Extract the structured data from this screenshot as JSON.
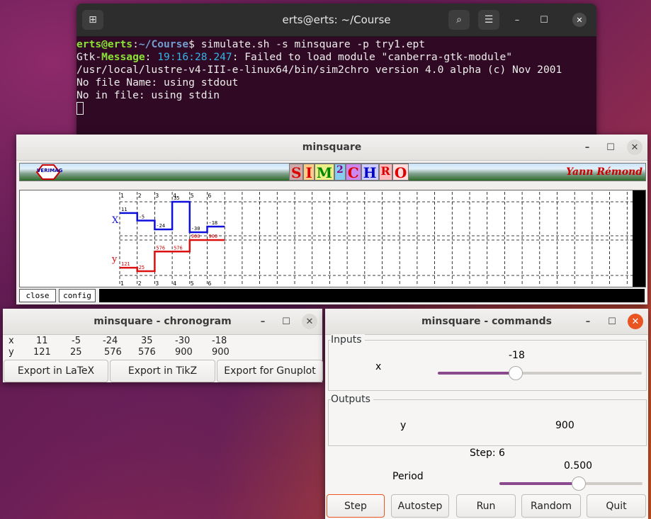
{
  "terminal": {
    "title": "erts@erts: ~/Course",
    "newtab_icon": "new-tab-icon",
    "lines": {
      "prompt_user": "erts@erts",
      "prompt_sep": ":",
      "prompt_path": "~/Course",
      "prompt_cmd": "$ simulate.sh -s minsquare -p try1.ept",
      "msg_tag": "Gtk-",
      "msg_tag2": "Message",
      "msg_colon": ": ",
      "msg_time": "19:16:28.247",
      "msg_text": ": Failed to load module \"canberra-gtk-module\"",
      "l3": "/usr/local/lustre-v4-III-e-linux64/bin/sim2chro version 4.0 alpha (c) Nov 2001",
      "l4": "No file Name: using stdout",
      "l5": "No in file: using stdin"
    }
  },
  "sim": {
    "title": "minsquare",
    "banner_left": "VERIMAG",
    "banner_letters": [
      "S",
      "I",
      "M",
      "2",
      "C",
      "H",
      "R",
      "O"
    ],
    "banner_right": "Yann Rémond",
    "ticks": [
      "1",
      "2",
      "3",
      "4",
      "5",
      "6"
    ],
    "x_label": "X",
    "y_label": "y",
    "x_values": [
      "11",
      "-5",
      "-24",
      "35",
      "-30",
      "-18"
    ],
    "y_values": [
      "121",
      "25",
      "576",
      "576",
      "900",
      "900"
    ],
    "close_label": "close",
    "config_label": "config"
  },
  "chrono": {
    "title": "minsquare - chronogram",
    "x_label": "x",
    "y_label": "y",
    "x_values": [
      "11",
      "-5",
      "-24",
      "35",
      "-30",
      "-18"
    ],
    "y_values": [
      "121",
      "25",
      "576",
      "576",
      "900",
      "900"
    ],
    "btn_latex": "Export in LaTeX",
    "btn_tikz": "Export in TikZ",
    "btn_gnuplot": "Export for Gnuplot"
  },
  "commands": {
    "title": "minsquare - commands",
    "inputs_label": "Inputs",
    "x_name": "x",
    "x_value": "-18",
    "x_slider_fraction": 0.38,
    "outputs_label": "Outputs",
    "y_name": "y",
    "y_value": "900",
    "step_text": "Step: 6",
    "period_label": "Period",
    "period_value": "0.500",
    "period_slider_fraction": 0.55,
    "buttons": {
      "step": "Step",
      "autostep": "Autostep",
      "run": "Run",
      "random": "Random",
      "quit": "Quit"
    }
  },
  "colors": {
    "accent": "#8b4a8d",
    "close_red": "#e95420",
    "x_signal": "#1010dd",
    "y_signal": "#dd1010"
  }
}
